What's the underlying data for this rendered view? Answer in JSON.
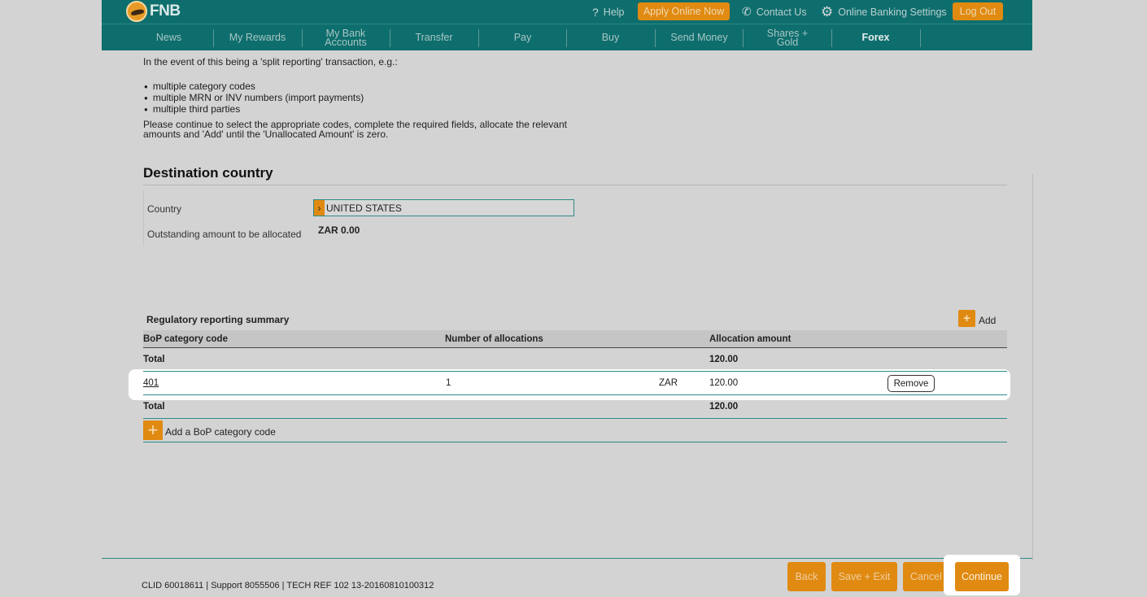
{
  "header": {
    "logo_text": "FNB",
    "help_label": "Help",
    "apply_label": "Apply Online Now",
    "contact_label": "Contact Us",
    "settings_label": "Online Banking Settings",
    "logout_label": "Log Out",
    "accent": "#e08a12",
    "brand": "#0e6e6d"
  },
  "nav": {
    "items": [
      {
        "label": "News"
      },
      {
        "label": "My Rewards"
      },
      {
        "label": "My Bank Accounts"
      },
      {
        "label": "Transfer"
      },
      {
        "label": "Pay"
      },
      {
        "label": "Buy"
      },
      {
        "label": "Send Money"
      },
      {
        "label": "Shares + Gold"
      },
      {
        "label": "Forex"
      }
    ],
    "active": "Forex"
  },
  "info": {
    "intro": "In the event of this being a 'split reporting' transaction, e.g.:",
    "bullets": [
      "multiple category codes",
      "multiple MRN or INV numbers (import payments)",
      "multiple third parties"
    ],
    "instruction_1": "Please continue to select the appropriate codes, complete the required fields, allocate the relevant",
    "instruction_2": "amounts and 'Add' until the 'Unallocated Amount' is zero."
  },
  "destination": {
    "title": "Destination country",
    "country_label": "Country",
    "country_value": "UNITED STATES",
    "outstanding_label": "Outstanding amount to be allocated",
    "outstanding_value": "ZAR 0.00"
  },
  "summary": {
    "title": "Regulatory reporting summary",
    "add_label": "Add",
    "columns": [
      "BoP category code",
      "Number of allocations",
      "Allocation amount"
    ],
    "total_label": "Total",
    "total_amount": "120.00",
    "rows": [
      {
        "code": "401",
        "allocations": "1",
        "currency": "ZAR",
        "amount": "120.00",
        "action": "Remove"
      }
    ],
    "add_category_label": "Add a BoP category code"
  },
  "footer": {
    "info": "CLID 60018611 | Support 8055506 | TECH REF 102 13-20160810100312",
    "back_label": "Back",
    "save_exit_label": "Save + Exit",
    "cancel_label": "Cancel",
    "continue_label": "Continue"
  }
}
